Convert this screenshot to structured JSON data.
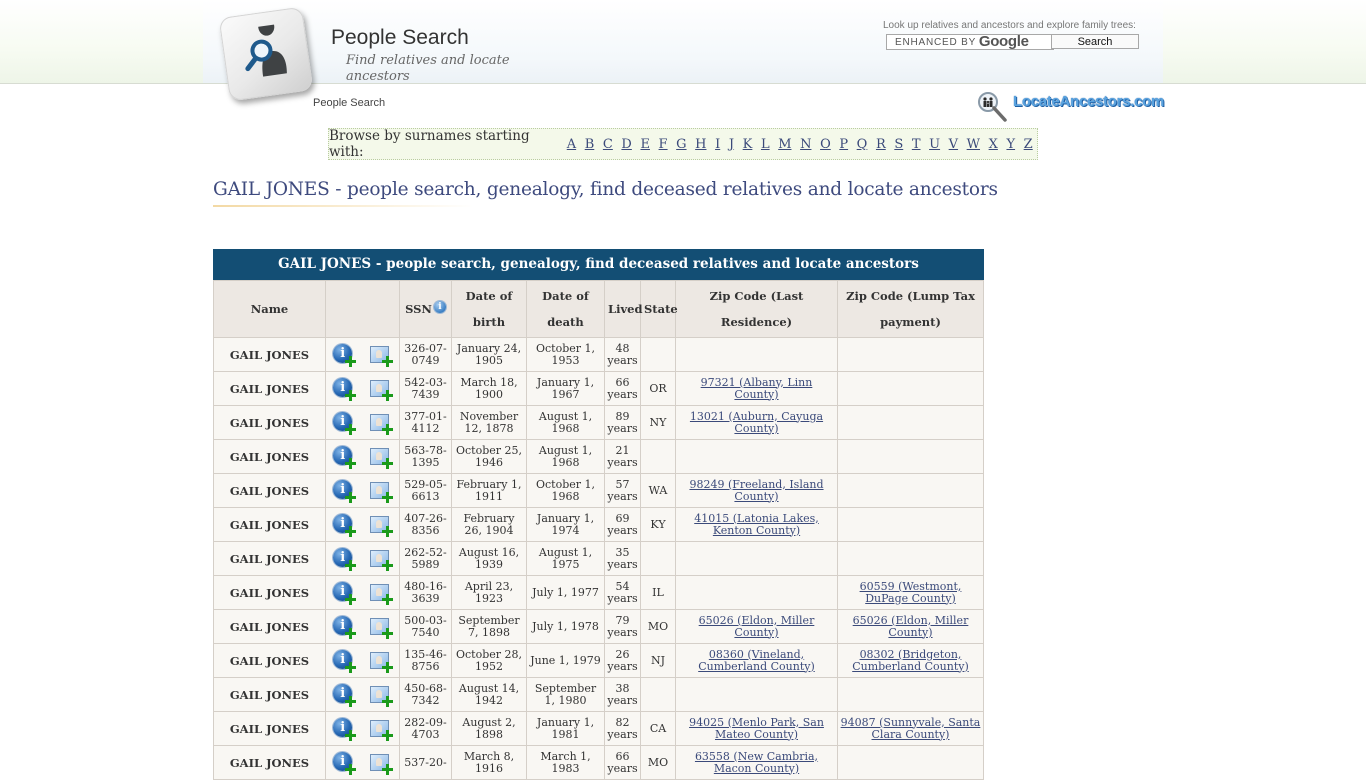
{
  "header": {
    "site_title": "People Search",
    "tagline": "Find relatives and locate ancestors",
    "breadcrumb": "People Search",
    "search_caption": "Look up relatives and ancestors and explore family trees:",
    "search_placeholder_enhanced": "ENHANCED BY",
    "search_placeholder_brand": "Google",
    "search_button": "Search",
    "brand_name": "LocateAncestors.com"
  },
  "alphabet": {
    "label": "Browse by surnames starting with:",
    "letters": [
      "A",
      "B",
      "C",
      "D",
      "E",
      "F",
      "G",
      "H",
      "I",
      "J",
      "K",
      "L",
      "M",
      "N",
      "O",
      "P",
      "Q",
      "R",
      "S",
      "T",
      "U",
      "V",
      "W",
      "X",
      "Y",
      "Z"
    ]
  },
  "page_heading": "GAIL JONES - people search, genealogy, find deceased relatives and locate ancestors",
  "table": {
    "caption": "GAIL JONES - people search, genealogy, find deceased relatives and locate ancestors",
    "headers": {
      "name": "Name",
      "actions": "",
      "ssn": "SSN",
      "dob": "Date of birth",
      "dod": "Date of death",
      "lived": "Lived",
      "state": "State",
      "zip_last": "Zip Code (Last Residence)",
      "zip_lump": "Zip Code (Lump Tax payment)"
    },
    "rows": [
      {
        "name": "GAIL JONES",
        "ssn": "326-07-0749",
        "dob": "January 24, 1905",
        "dod": "October 1, 1953",
        "lived": "48 years",
        "state": "",
        "zip_last": "",
        "zip_lump": ""
      },
      {
        "name": "GAIL JONES",
        "ssn": "542-03-7439",
        "dob": "March 18, 1900",
        "dod": "January 1, 1967",
        "lived": "66 years",
        "state": "OR",
        "zip_last": "97321 (Albany, Linn County)",
        "zip_lump": ""
      },
      {
        "name": "GAIL JONES",
        "ssn": "377-01-4112",
        "dob": "November 12, 1878",
        "dod": "August 1, 1968",
        "lived": "89 years",
        "state": "NY",
        "zip_last": "13021 (Auburn, Cayuga County)",
        "zip_lump": ""
      },
      {
        "name": "GAIL JONES",
        "ssn": "563-78-1395",
        "dob": "October 25, 1946",
        "dod": "August 1, 1968",
        "lived": "21 years",
        "state": "",
        "zip_last": "",
        "zip_lump": ""
      },
      {
        "name": "GAIL JONES",
        "ssn": "529-05-6613",
        "dob": "February 1, 1911",
        "dod": "October 1, 1968",
        "lived": "57 years",
        "state": "WA",
        "zip_last": "98249 (Freeland, Island County)",
        "zip_lump": ""
      },
      {
        "name": "GAIL JONES",
        "ssn": "407-26-8356",
        "dob": "February 26, 1904",
        "dod": "January 1, 1974",
        "lived": "69 years",
        "state": "KY",
        "zip_last": "41015 (Latonia Lakes, Kenton County)",
        "zip_lump": ""
      },
      {
        "name": "GAIL JONES",
        "ssn": "262-52-5989",
        "dob": "August 16, 1939",
        "dod": "August 1, 1975",
        "lived": "35 years",
        "state": "",
        "zip_last": "",
        "zip_lump": ""
      },
      {
        "name": "GAIL JONES",
        "ssn": "480-16-3639",
        "dob": "April 23, 1923",
        "dod": "July 1, 1977",
        "lived": "54 years",
        "state": "IL",
        "zip_last": "",
        "zip_lump": "60559 (Westmont, DuPage County)"
      },
      {
        "name": "GAIL JONES",
        "ssn": "500-03-7540",
        "dob": "September 7, 1898",
        "dod": "July 1, 1978",
        "lived": "79 years",
        "state": "MO",
        "zip_last": "65026 (Eldon, Miller County)",
        "zip_lump": "65026 (Eldon, Miller County)"
      },
      {
        "name": "GAIL JONES",
        "ssn": "135-46-8756",
        "dob": "October 28, 1952",
        "dod": "June 1, 1979",
        "lived": "26 years",
        "state": "NJ",
        "zip_last": "08360 (Vineland, Cumberland County)",
        "zip_lump": "08302 (Bridgeton, Cumberland County)"
      },
      {
        "name": "GAIL JONES",
        "ssn": "450-68-7342",
        "dob": "August 14, 1942",
        "dod": "September 1, 1980",
        "lived": "38 years",
        "state": "",
        "zip_last": "",
        "zip_lump": ""
      },
      {
        "name": "GAIL JONES",
        "ssn": "282-09-4703",
        "dob": "August 2, 1898",
        "dod": "January 1, 1981",
        "lived": "82 years",
        "state": "CA",
        "zip_last": "94025 (Menlo Park, San Mateo County)",
        "zip_lump": "94087 (Sunnyvale, Santa Clara County)"
      },
      {
        "name": "GAIL JONES",
        "ssn": "537-20-",
        "dob": "March 8, 1916",
        "dod": "March 1, 1983",
        "lived": "66 years",
        "state": "MO",
        "zip_last": "63558 (New Cambria, Macon County)",
        "zip_lump": ""
      }
    ]
  },
  "icons": {
    "logo": "magnifier-person-key-icon",
    "brand": "magnifier-family-icon",
    "row_info": "info-add-icon",
    "row_photo": "photo-add-icon",
    "ssn_help": "info-icon"
  },
  "colors": {
    "caption_bg": "#134e74",
    "header_cell_bg": "#ede8e3",
    "cell_bg": "#f9f7f3",
    "link": "#3b4a7a",
    "heading": "#3e4a7e",
    "alpha_bar_bg": "#f4f9ea",
    "plus_green": "#1a9a1a"
  }
}
